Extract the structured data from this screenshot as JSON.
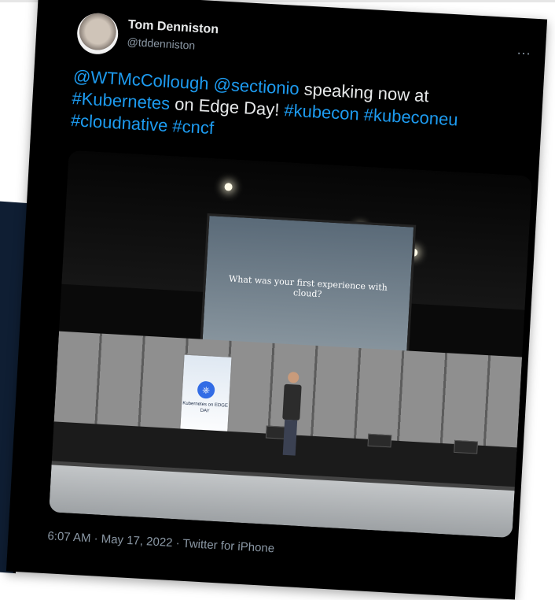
{
  "tweet": {
    "author_name": "Tom Denniston",
    "author_handle": "@tddenniston",
    "more_icon": "...",
    "text_parts": {
      "m1": "@WTMcCollough",
      "m2": "@sectionio",
      "t1": " speaking now at",
      "h1": "#Kubernetes",
      "t2": " on Edge Day! ",
      "h2": "#kubecon",
      "h3": "#kubeconeu",
      "h4": "#cloudnative",
      "h5": "#cncf"
    },
    "timestamp": "6:07 AM · May 17, 2022 · Twitter for iPhone"
  },
  "photo": {
    "screen_text": "What was your first experience with cloud?",
    "banner_logo": "⎈",
    "banner_text": "Kubernetes on EDGE DAY"
  },
  "colors": {
    "background": "#000000",
    "link": "#1d9bf0",
    "text": "#e7e9ea",
    "muted": "#8b98a5"
  }
}
